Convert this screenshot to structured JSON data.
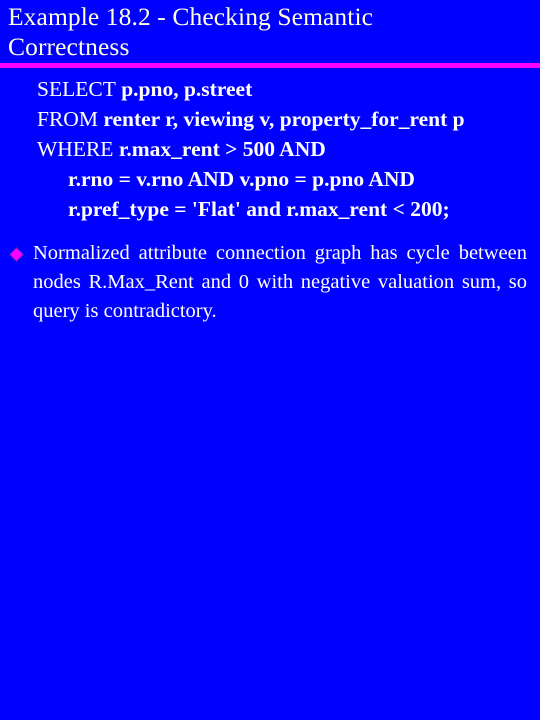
{
  "slide": {
    "background_color": "#0000ff",
    "title": {
      "lines": [
        "Example 18.2 - Checking Semantic",
        "Correctness"
      ],
      "color": "#ffffe0"
    },
    "divider": {
      "color": "#ff00ff"
    },
    "code_block": {
      "color": "#ffffff",
      "lines": [
        {
          "indent": false,
          "keyword": "SELECT",
          "rest": " p.pno, p.street",
          "text": "SELECT p.pno, p.street"
        },
        {
          "indent": false,
          "keyword": "FROM",
          "rest": " renter r, viewing v, property_for_rent p",
          "text": "FROM renter r, viewing v, property_for_rent p"
        },
        {
          "indent": false,
          "keyword": "WHERE",
          "rest": " r.max_rent > 500 AND",
          "text": "WHERE r.max_rent > 500 AND"
        },
        {
          "indent": true,
          "keyword": "",
          "rest": "r.rno = v.rno AND v.pno = p.pno AND",
          "text": "r.rno = v.rno AND v.pno = p.pno AND"
        },
        {
          "indent": true,
          "keyword": "",
          "rest": "r.pref_type = 'Flat' and r.max_rent < 200;",
          "text": "r.pref_type = 'Flat' and r.max_rent < 200;"
        }
      ]
    },
    "bullets": [
      {
        "marker": "diamond-bullet-icon",
        "marker_color": "#ff00ff",
        "text_main": "Normalized attribute connection graph has cycle between nodes R.Max_Rent and 0 with negative",
        "text_last": "valuation sum, so query is contradictory.",
        "text_full": "Normalized attribute connection graph has cycle between nodes R.Max_Rent and 0 with negative valuation sum, so query is contradictory."
      }
    ]
  }
}
